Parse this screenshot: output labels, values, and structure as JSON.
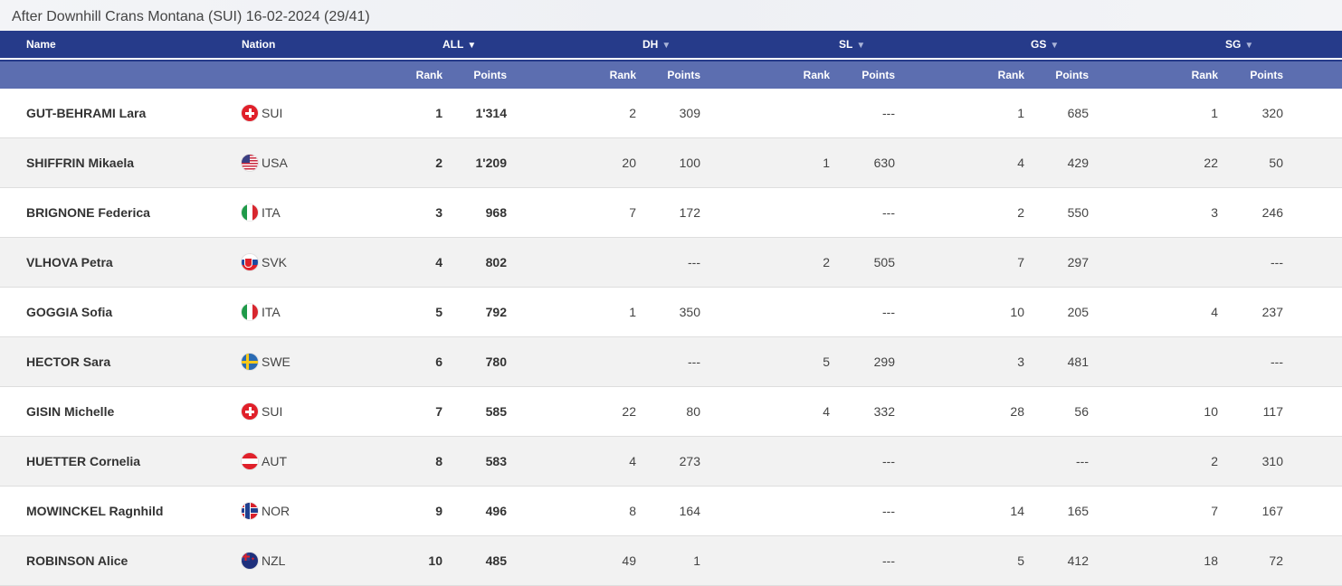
{
  "caption": "After Downhill Crans Montana (SUI) 16-02-2024 (29/41)",
  "header": {
    "name": "Name",
    "nation": "Nation",
    "disciplines": [
      {
        "label": "ALL",
        "arrow": "▼",
        "active": true
      },
      {
        "label": "DH",
        "arrow": "▼",
        "active": false
      },
      {
        "label": "SL",
        "arrow": "▼",
        "active": false
      },
      {
        "label": "GS",
        "arrow": "▼",
        "active": false
      },
      {
        "label": "SG",
        "arrow": "▼",
        "active": false
      }
    ],
    "rank_label": "Rank",
    "points_label": "Points"
  },
  "rows": [
    {
      "name": "GUT-BEHRAMI Lara",
      "nation": "SUI",
      "flag": "sui",
      "all_rank": "1",
      "all_points": "1'314",
      "dh_rank": "2",
      "dh_points": "309",
      "sl_rank": "",
      "sl_points": "---",
      "gs_rank": "1",
      "gs_points": "685",
      "sg_rank": "1",
      "sg_points": "320"
    },
    {
      "name": "SHIFFRIN Mikaela",
      "nation": "USA",
      "flag": "usa",
      "all_rank": "2",
      "all_points": "1'209",
      "dh_rank": "20",
      "dh_points": "100",
      "sl_rank": "1",
      "sl_points": "630",
      "gs_rank": "4",
      "gs_points": "429",
      "sg_rank": "22",
      "sg_points": "50"
    },
    {
      "name": "BRIGNONE Federica",
      "nation": "ITA",
      "flag": "ita",
      "all_rank": "3",
      "all_points": "968",
      "dh_rank": "7",
      "dh_points": "172",
      "sl_rank": "",
      "sl_points": "---",
      "gs_rank": "2",
      "gs_points": "550",
      "sg_rank": "3",
      "sg_points": "246"
    },
    {
      "name": "VLHOVA Petra",
      "nation": "SVK",
      "flag": "svk",
      "all_rank": "4",
      "all_points": "802",
      "dh_rank": "",
      "dh_points": "---",
      "sl_rank": "2",
      "sl_points": "505",
      "gs_rank": "7",
      "gs_points": "297",
      "sg_rank": "",
      "sg_points": "---"
    },
    {
      "name": "GOGGIA Sofia",
      "nation": "ITA",
      "flag": "ita",
      "all_rank": "5",
      "all_points": "792",
      "dh_rank": "1",
      "dh_points": "350",
      "sl_rank": "",
      "sl_points": "---",
      "gs_rank": "10",
      "gs_points": "205",
      "sg_rank": "4",
      "sg_points": "237"
    },
    {
      "name": "HECTOR Sara",
      "nation": "SWE",
      "flag": "swe",
      "all_rank": "6",
      "all_points": "780",
      "dh_rank": "",
      "dh_points": "---",
      "sl_rank": "5",
      "sl_points": "299",
      "gs_rank": "3",
      "gs_points": "481",
      "sg_rank": "",
      "sg_points": "---"
    },
    {
      "name": "GISIN Michelle",
      "nation": "SUI",
      "flag": "sui",
      "all_rank": "7",
      "all_points": "585",
      "dh_rank": "22",
      "dh_points": "80",
      "sl_rank": "4",
      "sl_points": "332",
      "gs_rank": "28",
      "gs_points": "56",
      "sg_rank": "10",
      "sg_points": "117"
    },
    {
      "name": "HUETTER Cornelia",
      "nation": "AUT",
      "flag": "aut",
      "all_rank": "8",
      "all_points": "583",
      "dh_rank": "4",
      "dh_points": "273",
      "sl_rank": "",
      "sl_points": "---",
      "gs_rank": "",
      "gs_points": "---",
      "sg_rank": "2",
      "sg_points": "310"
    },
    {
      "name": "MOWINCKEL Ragnhild",
      "nation": "NOR",
      "flag": "nor",
      "all_rank": "9",
      "all_points": "496",
      "dh_rank": "8",
      "dh_points": "164",
      "sl_rank": "",
      "sl_points": "---",
      "gs_rank": "14",
      "gs_points": "165",
      "sg_rank": "7",
      "sg_points": "167"
    },
    {
      "name": "ROBINSON Alice",
      "nation": "NZL",
      "flag": "nzl",
      "all_rank": "10",
      "all_points": "485",
      "dh_rank": "49",
      "dh_points": "1",
      "sl_rank": "",
      "sl_points": "---",
      "gs_rank": "5",
      "gs_points": "412",
      "sg_rank": "18",
      "sg_points": "72"
    }
  ]
}
